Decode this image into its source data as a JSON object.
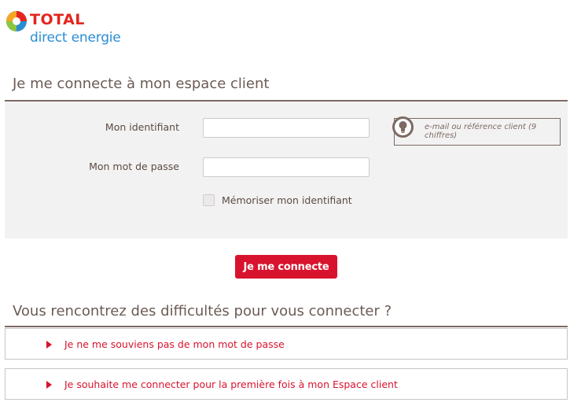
{
  "brand": {
    "name": "TOTAL",
    "subtitle": "direct energie"
  },
  "login": {
    "title": "Je me connecte à mon espace client",
    "identifier_label": "Mon identifiant",
    "identifier_value": "",
    "password_label": "Mon mot de passe",
    "password_value": "",
    "hint_text": "e-mail ou référence client (9 chiffres)",
    "remember_label": "Mémoriser mon identifiant",
    "remember_checked": false,
    "submit_label": "Je me connecte"
  },
  "help": {
    "title": "Vous rencontrez des difficultés pour vous connecter ?",
    "links": [
      {
        "label": "Je ne me souviens pas de mon mot de passe"
      },
      {
        "label": "Je souhaite me connecter pour la première fois à mon Espace client"
      }
    ]
  },
  "colors": {
    "accent_red": "#d8132e",
    "brand_blue": "#2a8dd4",
    "rule_brown": "#7c6a63",
    "panel_bg": "#f3f2f2"
  }
}
